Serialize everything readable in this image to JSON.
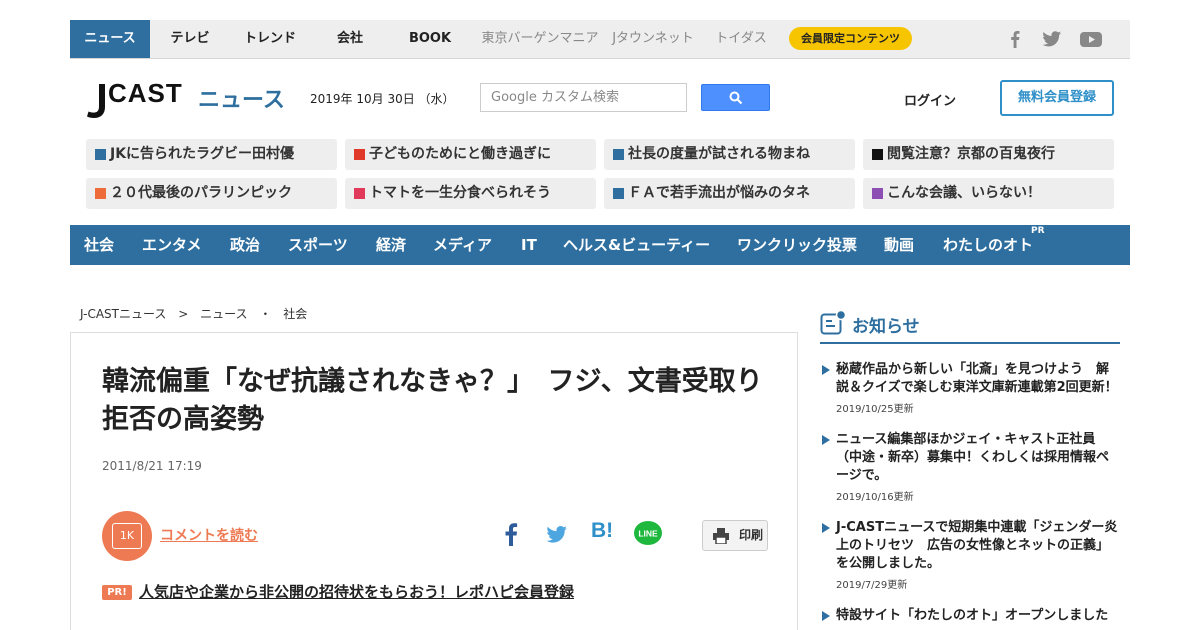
{
  "topnav": {
    "items": [
      "ニュース",
      "テレビ",
      "トレンド",
      "会社",
      "BOOK",
      "東京バーゲンマニア",
      "Jタウンネット",
      "トイダス"
    ],
    "member": "会員限定コンテンツ"
  },
  "header": {
    "logo_j": "J",
    "logo_cast": "CAST",
    "logo_news": "ニュース",
    "date": "2019年 10月 30日 （水）",
    "search_placeholder": "Google カスタム検索",
    "login": "ログイン",
    "register": "無料会員登録"
  },
  "topics": [
    {
      "label": "JKに告られたラグビー田村優",
      "color": "#2f6f9f"
    },
    {
      "label": "子どものためにと働き過ぎに",
      "color": "#e0392a"
    },
    {
      "label": "社長の度量が試される物まね",
      "color": "#2f6f9f"
    },
    {
      "label": "閲覧注意？京都の百鬼夜行",
      "color": "#111111"
    },
    {
      "label": "２０代最後のパラリンピック",
      "color": "#ee6c3a"
    },
    {
      "label": "トマトを一生分食べられそう",
      "color": "#e0395a"
    },
    {
      "label": "ＦＡで若手流出が悩みのタネ",
      "color": "#2f6f9f"
    },
    {
      "label": "こんな会議、いらない！",
      "color": "#8e4fb5"
    }
  ],
  "categories": [
    "社会",
    "エンタメ",
    "政治",
    "スポーツ",
    "経済",
    "メディア",
    "IT",
    "ヘルス&ビューティー",
    "ワンクリック投票",
    "動画",
    "わたしのオト"
  ],
  "category_pr": "PR",
  "breadcrumb": [
    "J-CASTニュース",
    ">",
    "ニュース",
    "・",
    "社会"
  ],
  "article": {
    "title": "韓流偏重「なぜ抗議されなきゃ？」　フジ、文書受取り拒否の高姿勢",
    "date": "2011/8/21 17:19",
    "comment_count": "1K",
    "comment_link": "コメントを読む",
    "print": "印刷",
    "pr_badge": "PR!",
    "pr_link": "人気店や企業から非公開の招待状をもらおう！レポハピ会員登録"
  },
  "sidebar": {
    "title": "お知らせ",
    "notices": [
      {
        "text": "秘蔵作品から新しい「北斎」を見つけよう　解説＆クイズで楽しむ東洋文庫新連載第2回更新！",
        "date": "2019/10/25更新"
      },
      {
        "text": "ニュース編集部ほかジェイ・キャスト正社員（中途・新卒）募集中！くわしくは採用情報ページで。",
        "date": "2019/10/16更新"
      },
      {
        "text": "J-CASTニュースで短期集中連載「ジェンダー炎上のトリセツ　広告の女性像とネットの正義」を公開しました。",
        "date": "2019/7/29更新"
      },
      {
        "text": "特設サイト「わたしのオト」オープンしました",
        "date": ""
      }
    ]
  },
  "colors": {
    "brand_blue": "#2f6f9f",
    "accent_orange": "#ee7a53",
    "member_yellow": "#f7c500"
  }
}
